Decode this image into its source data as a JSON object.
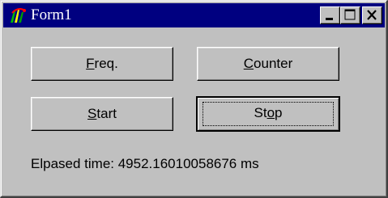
{
  "window": {
    "title": "Form1",
    "app_icon": "delphi-app-icon",
    "caption_buttons": {
      "minimize_icon": "minimize-icon",
      "maximize_icon": "maximize-icon",
      "close_icon": "close-icon"
    }
  },
  "buttons": {
    "freq": {
      "mnemonic": "F",
      "rest": "req."
    },
    "counter": {
      "mnemonic": "C",
      "rest": "ounter"
    },
    "start": {
      "mnemonic": "S",
      "rest": "tart"
    },
    "stop": {
      "before": "St",
      "mnemonic": "o",
      "after": "p",
      "is_default": true
    }
  },
  "status": {
    "elapsed_label": "Elpased time: 4952.16010058676 ms"
  },
  "colors": {
    "face": "#c0c0c0",
    "titlebar": "#000080",
    "title_text": "#ffffff"
  }
}
